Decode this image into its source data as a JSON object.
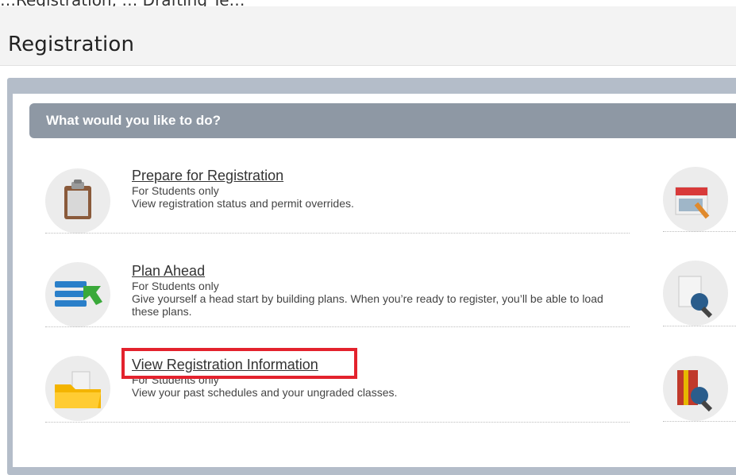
{
  "page": {
    "top_cut_text": "…Registration, … Drafting Te…",
    "title": "Registration"
  },
  "panel": {
    "heading": "What would you like to do?"
  },
  "options": [
    {
      "link": "Prepare for Registration",
      "subtitle": "For Students only",
      "description": "View registration status and permit overrides.",
      "icon": "clipboard-icon"
    },
    {
      "link": "Plan Ahead",
      "subtitle": "For Students only",
      "description": "Give yourself a head start by building plans. When you’re ready to register, you’ll be able to load these plans.",
      "icon": "plan-list-icon"
    },
    {
      "link": "View Registration Information",
      "subtitle": "For Students only",
      "description": "View your past schedules and your ungraded classes.",
      "icon": "folder-icon"
    }
  ],
  "right_icons": [
    "calendar-icon",
    "document-search-icon",
    "book-search-icon"
  ],
  "colors": {
    "header_bar": "#8e98a4",
    "outer_panel": "#b4bdc9",
    "highlight": "#e3222d"
  }
}
